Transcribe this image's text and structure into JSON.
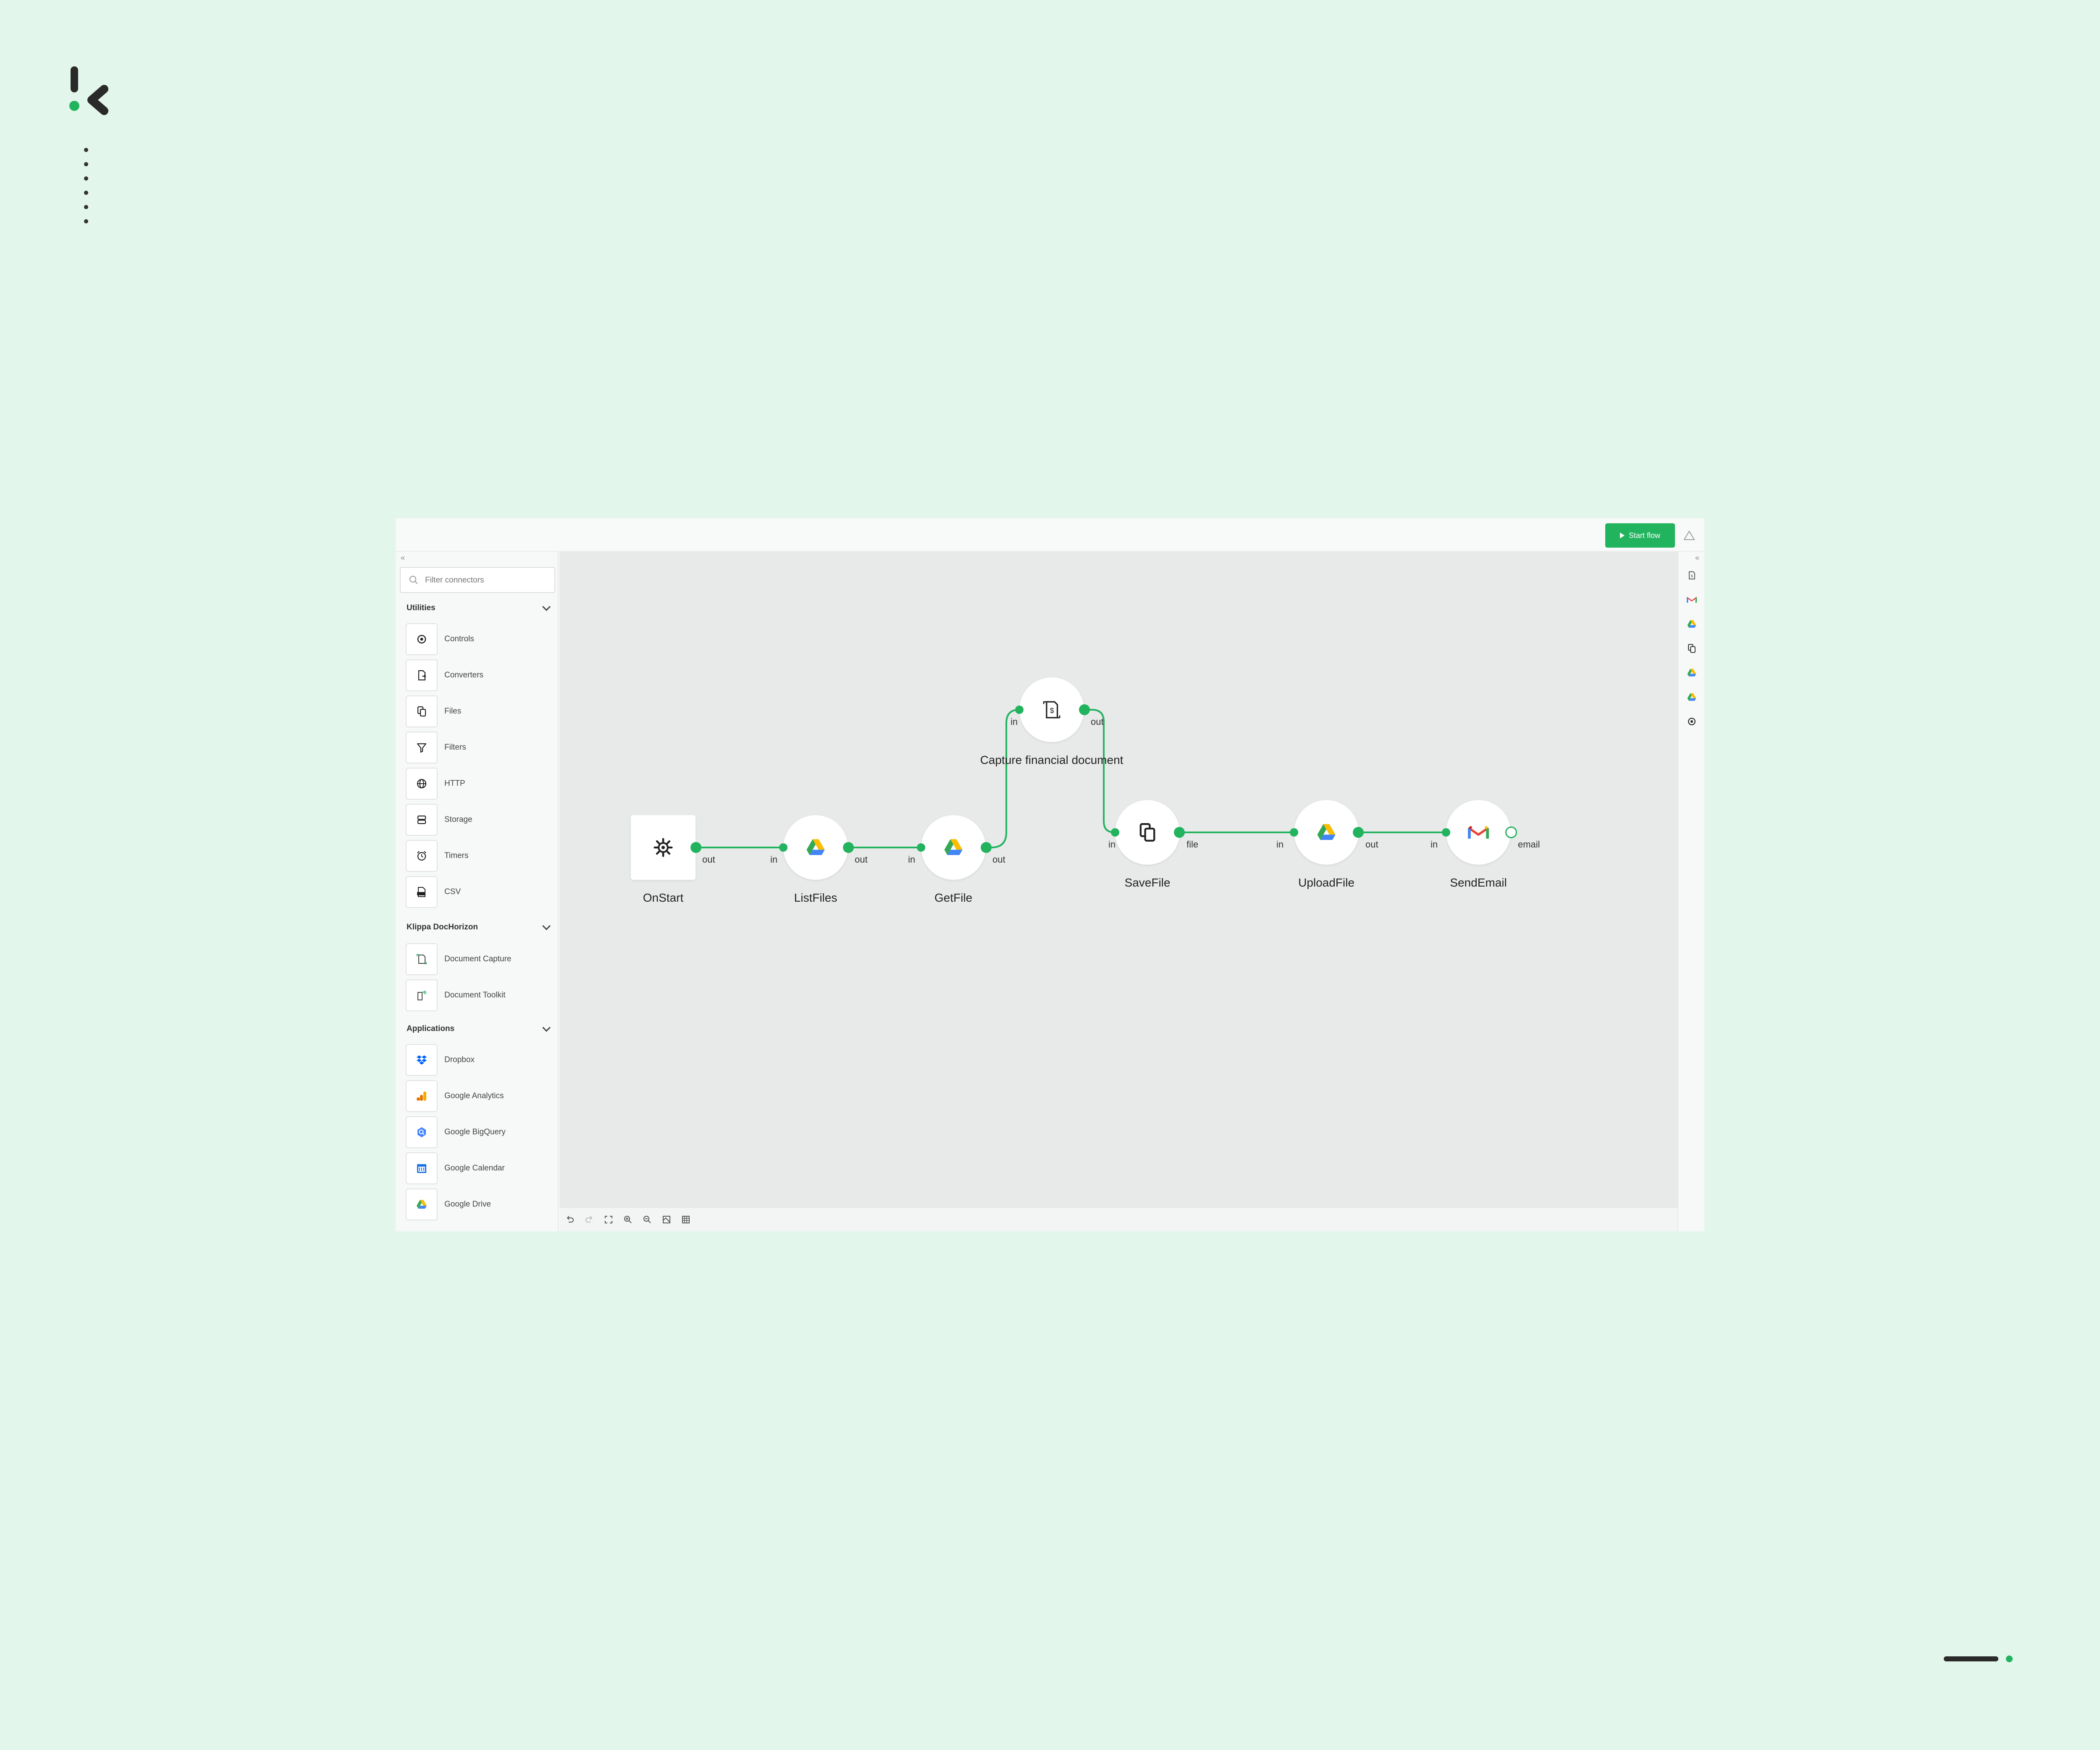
{
  "toolbar": {
    "start_label": "Start flow"
  },
  "sidebar": {
    "filter_placeholder": "Filter connectors",
    "sections": [
      {
        "title": "Utilities",
        "items": [
          "Controls",
          "Converters",
          "Files",
          "Filters",
          "HTTP",
          "Storage",
          "Timers",
          "CSV"
        ]
      },
      {
        "title": "Klippa DocHorizon",
        "items": [
          "Document Capture",
          "Document Toolkit"
        ]
      },
      {
        "title": "Applications",
        "items": [
          "Dropbox",
          "Google Analytics",
          "Google BigQuery",
          "Google Calendar",
          "Google Drive"
        ]
      }
    ]
  },
  "flow": {
    "nodes": [
      {
        "label": "OnStart",
        "icon": "gear-icon"
      },
      {
        "label": "ListFiles",
        "icon": "google-drive-icon"
      },
      {
        "label": "GetFile",
        "icon": "google-drive-icon"
      },
      {
        "label": "Capture financial document",
        "icon": "document-capture-icon"
      },
      {
        "label": "SaveFile",
        "icon": "files-icon"
      },
      {
        "label": "UploadFile",
        "icon": "google-drive-icon"
      },
      {
        "label": "SendEmail",
        "icon": "gmail-icon"
      }
    ],
    "ports": {
      "out": "out",
      "in": "in",
      "file": "file",
      "email": "email"
    }
  },
  "rail_icons": [
    "document-capture-icon",
    "gmail-icon",
    "google-drive-icon",
    "files-icon",
    "google-drive-icon",
    "google-drive-icon",
    "gear-icon"
  ],
  "colors": {
    "accent": "#22b35e",
    "background": "#e3f6ec",
    "canvas": "#e8e9e9"
  }
}
